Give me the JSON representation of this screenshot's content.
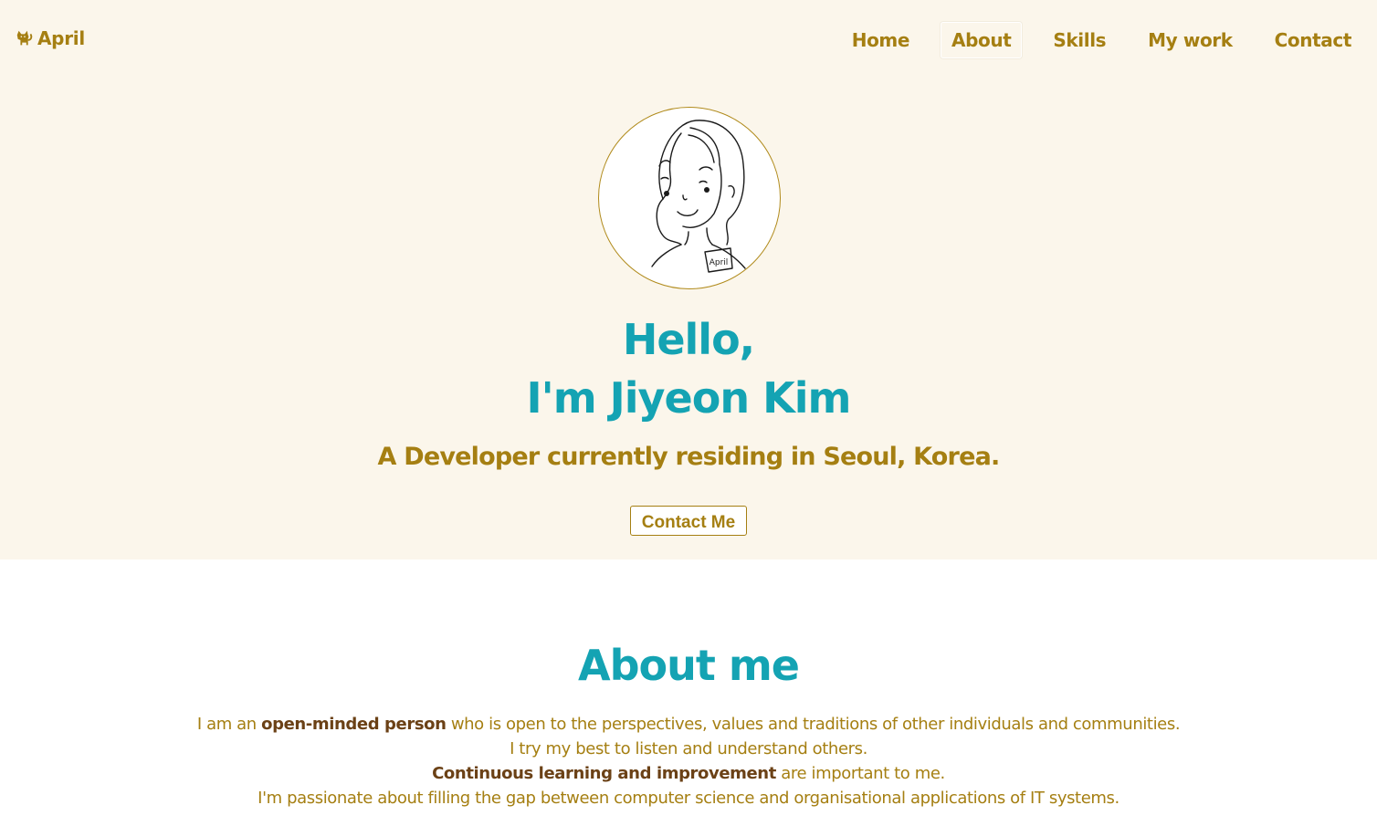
{
  "nav": {
    "brand": "April",
    "brand_icon": "cat-icon",
    "items": [
      {
        "label": "Home",
        "active": false
      },
      {
        "label": "About",
        "active": true
      },
      {
        "label": "Skills",
        "active": false
      },
      {
        "label": "My work",
        "active": false
      },
      {
        "label": "Contact",
        "active": false
      }
    ]
  },
  "hero": {
    "avatar_badge": "April",
    "greeting_line1": "Hello,",
    "greeting_line2": "I'm Jiyeon Kim",
    "subtitle": "A Developer currently residing in Seoul, Korea.",
    "contact_button": "Contact Me"
  },
  "about": {
    "title": "About me",
    "line1_pre": "I am an ",
    "line1_bold": "open-minded person",
    "line1_post": " who is open to the perspectives, values and traditions of other individuals and communities.",
    "line2": "I try my best to listen and understand others.",
    "line3_bold": "Continuous learning and improvement",
    "line3_post": " are important to me.",
    "line4": "I'm passionate about filling the gap between computer science and organisational applications of IT systems."
  },
  "colors": {
    "hero_bg": "#fbf6eb",
    "accent_gold": "#a57f12",
    "accent_teal": "#14a3b3",
    "emphasis_brown": "#6b4116"
  }
}
